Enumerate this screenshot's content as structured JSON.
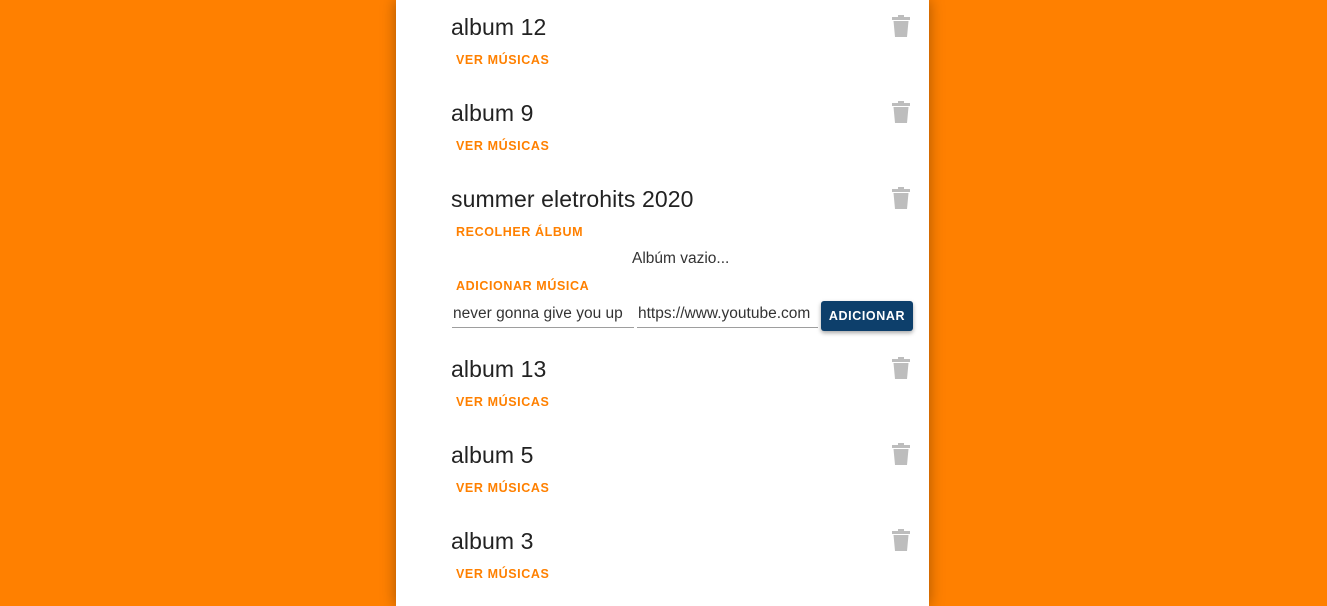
{
  "colors": {
    "background": "#ff8000",
    "panel": "#ffffff",
    "accent": "#ff8000",
    "button": "#0d3f6b",
    "trash_icon": "#bdbdbd"
  },
  "albums": [
    {
      "title": "album 12",
      "toggle_label": "VER MÚSICAS",
      "delete_icon": "trash-icon"
    },
    {
      "title": "album 9",
      "toggle_label": "VER MÚSICAS",
      "delete_icon": "trash-icon"
    },
    {
      "title": "summer eletrohits 2020",
      "toggle_label": "RECOLHER ÁLBUM",
      "delete_icon": "trash-icon",
      "expanded": true,
      "empty_message": "Albúm vazio...",
      "add_song_label": "ADICIONAR MÚSICA",
      "song_name_value": "never gonna give you up",
      "song_url_value": "https://www.youtube.com",
      "add_button_label": "ADICIONAR"
    },
    {
      "title": "album 13",
      "toggle_label": "VER MÚSICAS",
      "delete_icon": "trash-icon"
    },
    {
      "title": "album 5",
      "toggle_label": "VER MÚSICAS",
      "delete_icon": "trash-icon"
    },
    {
      "title": "album 3",
      "toggle_label": "VER MÚSICAS",
      "delete_icon": "trash-icon"
    }
  ]
}
